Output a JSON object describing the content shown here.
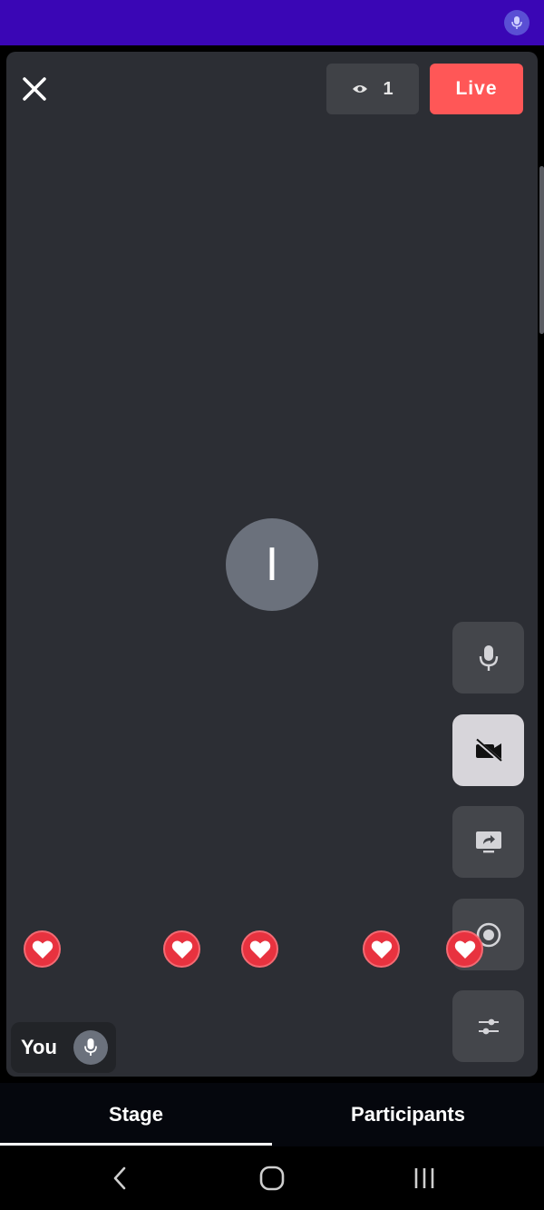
{
  "header": {
    "viewer_count": "1",
    "live_label": "Live"
  },
  "stage": {
    "participant_initial": "I",
    "self_label": "You"
  },
  "controls": [
    {
      "name": "mic-toggle-button",
      "icon": "microphone-icon",
      "active": false
    },
    {
      "name": "camera-toggle-button",
      "icon": "video-off-icon",
      "active": true
    },
    {
      "name": "screen-share-button",
      "icon": "screen-share-icon",
      "active": false
    },
    {
      "name": "record-button",
      "icon": "record-icon",
      "active": false
    },
    {
      "name": "settings-button",
      "icon": "sliders-icon",
      "active": false
    }
  ],
  "reactions": {
    "icon": "heart-icon",
    "count": 5
  },
  "tabs": [
    {
      "label": "Stage",
      "selected": true
    },
    {
      "label": "Participants",
      "selected": false
    }
  ],
  "colors": {
    "status_bar": "#3a06b5",
    "stage_bg": "#2c2e34",
    "live": "#ff5757",
    "heart": "#e8323f"
  }
}
